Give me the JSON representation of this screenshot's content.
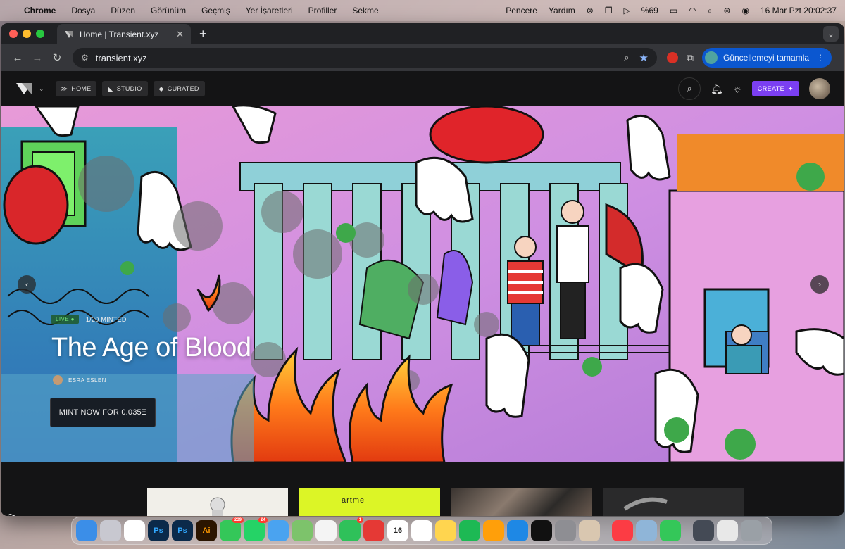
{
  "menubar": {
    "app": "Chrome",
    "items": [
      "Dosya",
      "Düzen",
      "Görünüm",
      "Geçmiş",
      "Yer İşaretleri",
      "Profiller",
      "Sekme"
    ],
    "right_items": [
      "Pencere",
      "Yardım"
    ],
    "battery": "%69",
    "datetime": "16 Mar Pzt  20:02:37"
  },
  "browser": {
    "tab_title": "Home | Transient.xyz",
    "url": "transient.xyz",
    "update_button": "Güncellemeyi tamamla"
  },
  "site": {
    "nav": [
      {
        "label": "HOME",
        "icon": "chevrons-icon"
      },
      {
        "label": "STUDIO",
        "icon": "studio-icon"
      },
      {
        "label": "CURATED",
        "icon": "diamond-icon"
      }
    ],
    "create_label": "CREATE",
    "hero": {
      "live_label": "LIVE",
      "minted": "1/20 MINTED",
      "title": "The Age of Blood",
      "artist": "ESRA ESLEN",
      "mint_button": "MINT NOW FOR 0.035Ξ"
    },
    "card2_text": "artme"
  },
  "dock": {
    "apps": [
      {
        "name": "Finder",
        "label": "",
        "color": "#3b8ee8"
      },
      {
        "name": "Launchpad",
        "label": "",
        "color": "#c8c8d0"
      },
      {
        "name": "Chrome",
        "label": "",
        "color": "#ffffff"
      },
      {
        "name": "Photoshop",
        "label": "Ps",
        "color": "#0b2a4a"
      },
      {
        "name": "Photoshop",
        "label": "Ps",
        "color": "#0b2a4a"
      },
      {
        "name": "Illustrator",
        "label": "Ai",
        "color": "#2b1500"
      },
      {
        "name": "Messages",
        "label": "",
        "color": "#34c759",
        "badge": "239"
      },
      {
        "name": "WhatsApp",
        "label": "",
        "color": "#25d366",
        "badge": "24"
      },
      {
        "name": "Weather",
        "label": "",
        "color": "#4aa3f0"
      },
      {
        "name": "Maps",
        "label": "",
        "color": "#7dc36b"
      },
      {
        "name": "Photos",
        "label": "",
        "color": "#f4f4f4"
      },
      {
        "name": "FaceTime",
        "label": "",
        "color": "#2fc15a",
        "badge": "1"
      },
      {
        "name": "Screen Recorder",
        "label": "",
        "color": "#e53935"
      },
      {
        "name": "Calendar",
        "label": "16",
        "color": "#ffffff"
      },
      {
        "name": "Reminders",
        "label": "",
        "color": "#ffffff"
      },
      {
        "name": "Notes",
        "label": "",
        "color": "#ffd54f"
      },
      {
        "name": "Spotify",
        "label": "",
        "color": "#1db954"
      },
      {
        "name": "Pages",
        "label": "",
        "color": "#ff9f0a"
      },
      {
        "name": "App Store",
        "label": "",
        "color": "#1e88e5"
      },
      {
        "name": "Capture",
        "label": "",
        "color": "#111111"
      },
      {
        "name": "System Settings",
        "label": "",
        "color": "#8e8e93"
      },
      {
        "name": "iPhone Mirroring",
        "label": "",
        "color": "#d9c7b0"
      },
      {
        "name": "Music",
        "label": "",
        "color": "#fc3c44"
      },
      {
        "name": "Preview",
        "label": "",
        "color": "#8fb5d8"
      },
      {
        "name": "Numbers",
        "label": "",
        "color": "#34c759"
      },
      {
        "name": "Window 1",
        "label": "",
        "color": "#444a55"
      },
      {
        "name": "Window 2",
        "label": "",
        "color": "#e8e8e8"
      },
      {
        "name": "Trash",
        "label": "",
        "color": "#9aa0a6"
      }
    ]
  }
}
